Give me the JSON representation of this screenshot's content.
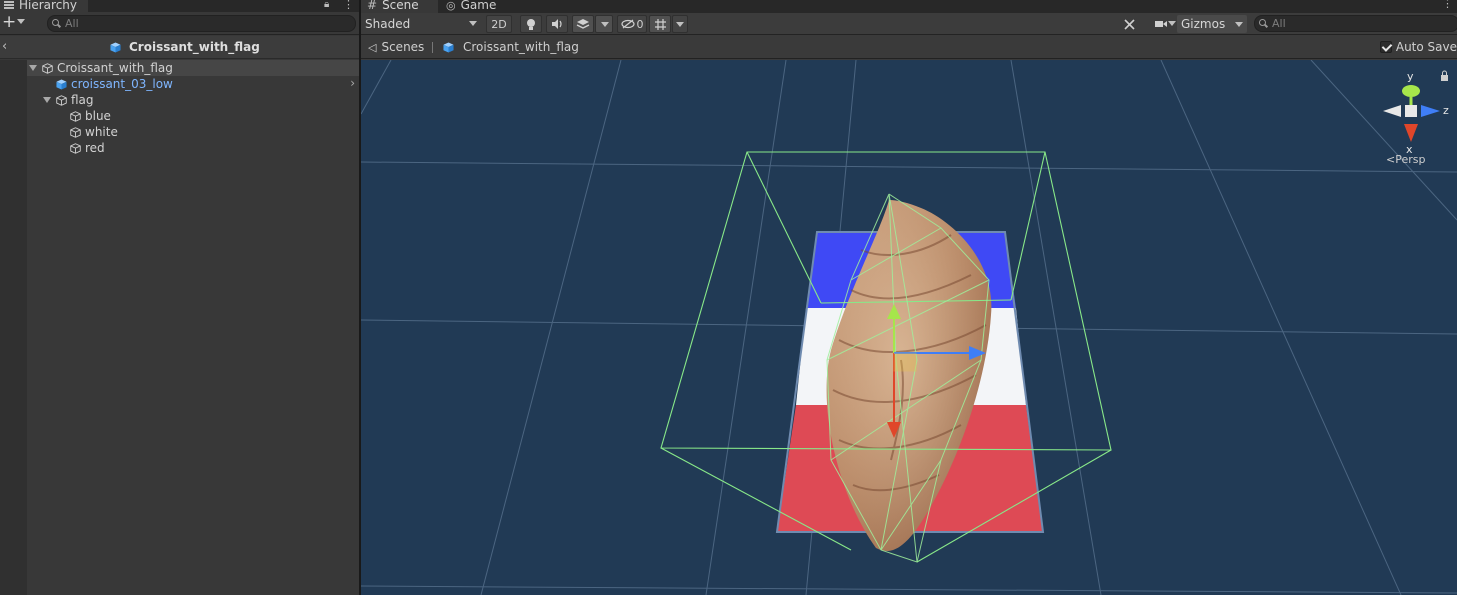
{
  "hierarchy": {
    "tab_label": "Hierarchy",
    "search_placeholder": "All",
    "prefab_title": "Croissant_with_flag",
    "tree": [
      {
        "label": "Croissant_with_flag",
        "depth": 0,
        "expanded": true,
        "selected": true,
        "icon": "cube-icon",
        "color": "#d2d2d2"
      },
      {
        "label": "croissant_03_low",
        "depth": 1,
        "expanded": false,
        "icon": "prefab-cube-icon",
        "color": "#7fb6ff",
        "has_arrow": true
      },
      {
        "label": "flag",
        "depth": 1,
        "expanded": true,
        "icon": "cube-icon",
        "color": "#d2d2d2"
      },
      {
        "label": "blue",
        "depth": 2,
        "icon": "cube-icon",
        "color": "#d2d2d2"
      },
      {
        "label": "white",
        "depth": 2,
        "icon": "cube-icon",
        "color": "#d2d2d2"
      },
      {
        "label": "red",
        "depth": 2,
        "icon": "cube-icon",
        "color": "#d2d2d2"
      }
    ]
  },
  "scene": {
    "tabs": [
      {
        "label": "Scene",
        "icon": "hash-icon",
        "active": true
      },
      {
        "label": "Game",
        "icon": "gamepad-icon",
        "active": false
      }
    ],
    "toolbar": {
      "shading": "Shaded",
      "mode_2d": "2D",
      "hidden_count": "0",
      "gizmos_label": "Gizmos",
      "search_placeholder": "All"
    },
    "breadcrumbs": {
      "scenes": "Scenes",
      "prefab": "Croissant_with_flag"
    },
    "auto_save": {
      "label": "Auto Save",
      "checked": true
    },
    "gizmo": {
      "y": "y",
      "x": "x",
      "z": "z",
      "persp": "Persp"
    }
  },
  "colors": {
    "viewport_bg": "#213a55",
    "flag_blue": "#3f49f5",
    "flag_white": "#f3f5f8",
    "flag_red": "#de4a55",
    "wireframe": "#88e889",
    "axis_y": "#a6e64b",
    "axis_x": "#e0462a",
    "axis_z": "#3f7ef7",
    "prefab_blue": "#7fb6ff"
  }
}
